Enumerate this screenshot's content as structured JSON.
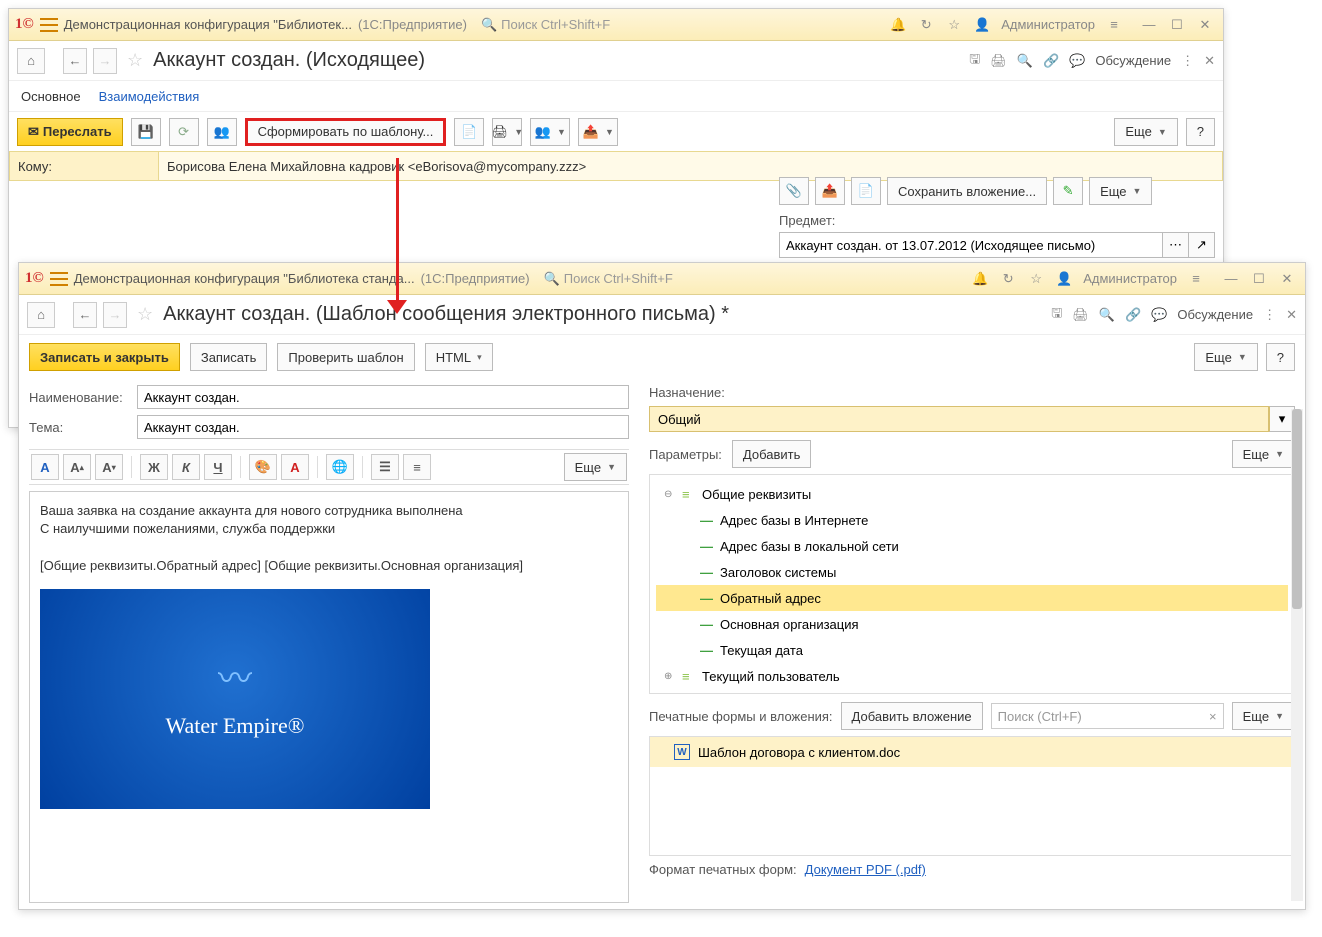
{
  "win1": {
    "title_config": "Демонстрационная конфигурация \"Библиотек...",
    "title_app": "(1С:Предприятие)",
    "search_placeholder": "Поиск Ctrl+Shift+F",
    "user": "Администратор",
    "page_title": "Аккаунт создан. (Исходящее)",
    "discuss": "Обсуждение",
    "tabs": {
      "main": "Основное",
      "interact": "Взаимодействия"
    },
    "toolbar": {
      "forward": "Переслать",
      "template_btn": "Сформировать по шаблону...",
      "more": "Еще",
      "help": "?"
    },
    "to_label": "Кому:",
    "to_value": "Борисова Елена Михайловна кадровик <eBorisova@mycompany.zzz>",
    "side": {
      "save_attach": "Сохранить вложение...",
      "more": "Еще",
      "subject_label": "Предмет:",
      "subject_value": "Аккаунт создан. от 13.07.2012 (Исходящее письмо)"
    }
  },
  "win2": {
    "title_config": "Демонстрационная конфигурация \"Библиотека станда...",
    "title_app": "(1С:Предприятие)",
    "search_placeholder": "Поиск Ctrl+Shift+F",
    "user": "Администратор",
    "page_title": "Аккаунт создан. (Шаблон сообщения электронного письма) *",
    "discuss": "Обсуждение",
    "toolbar": {
      "save_close": "Записать и закрыть",
      "save": "Записать",
      "check": "Проверить шаблон",
      "html": "HTML",
      "more": "Еще",
      "help": "?"
    },
    "name_label": "Наименование:",
    "name_value": "Аккаунт создан.",
    "theme_label": "Тема:",
    "theme_value": "Аккаунт создан.",
    "fmt_more": "Еще",
    "editor": {
      "line1": "Ваша заявка на создание аккаунта для нового сотрудника выполнена",
      "line2": "С наилучшими пожеланиями, служба поддержки",
      "line3": "[Общие реквизиты.Обратный адрес] [Общие реквизиты.Основная организация]",
      "logo_text": "Water Empire®"
    },
    "dest_label": "Назначение:",
    "dest_value": "Общий",
    "params_label": "Параметры:",
    "params_add": "Добавить",
    "params_more": "Еще",
    "tree": {
      "root": "Общие реквизиты",
      "items": [
        "Адрес базы в Интернете",
        "Адрес базы в локальной сети",
        "Заголовок системы",
        "Обратный адрес",
        "Основная организация",
        "Текущая дата"
      ],
      "last": "Текущий пользователь"
    },
    "attach": {
      "label": "Печатные формы и вложения:",
      "add": "Добавить вложение",
      "search": "Поиск (Ctrl+F)",
      "more": "Еще",
      "file": "Шаблон договора с клиентом.doc"
    },
    "footer": {
      "label": "Формат печатных форм:",
      "link": "Документ PDF (.pdf)"
    }
  }
}
